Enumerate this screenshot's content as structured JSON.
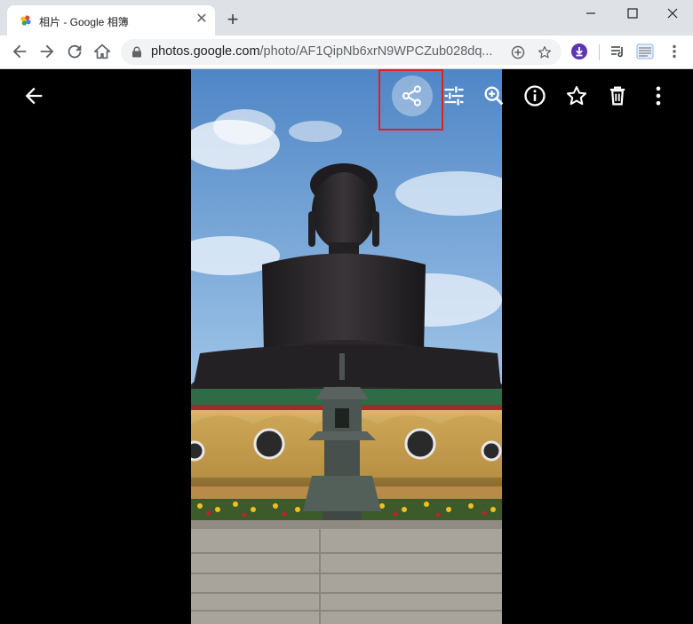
{
  "browser": {
    "tab": {
      "title": "相片 - Google 相簿",
      "close_icon": "close-icon"
    },
    "new_tab_label": "+",
    "window_controls": [
      "minimize-icon",
      "maximize-icon",
      "close-icon"
    ],
    "address": {
      "host": "photos.google.com",
      "path": "/photo/AF1QipNb6xrN9WPCZub028dq..."
    }
  },
  "viewer": {
    "toolbar": [
      "back-arrow-icon",
      "share-icon",
      "edit-adjust-icon",
      "zoom-in-icon",
      "info-icon",
      "star-icon",
      "delete-icon",
      "more-vert-icon"
    ],
    "highlight_color": "#e02020"
  },
  "colors": {
    "titlebar": "#dee1e6",
    "toolbar": "#ffffff",
    "viewer_bg": "#000000",
    "accent_purple": "#5e35b1"
  }
}
